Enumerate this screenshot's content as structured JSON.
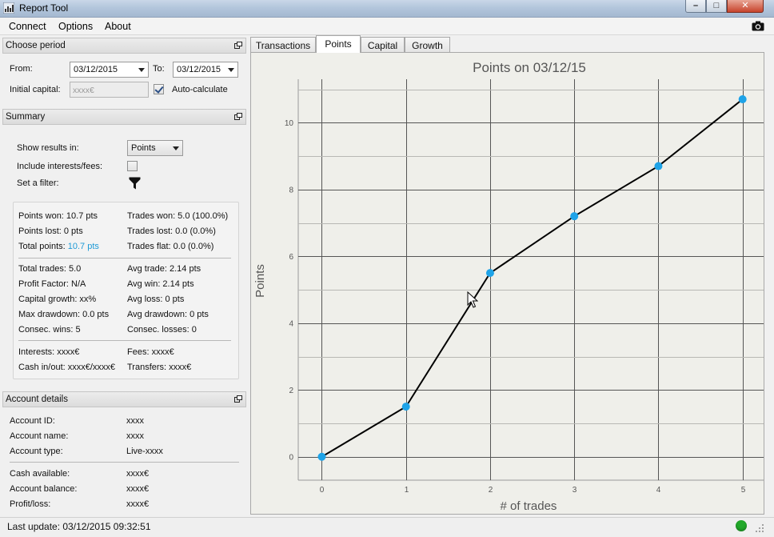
{
  "window": {
    "title": "Report Tool"
  },
  "menu": {
    "items": [
      "Connect",
      "Options",
      "About"
    ]
  },
  "choose_period": {
    "header": "Choose period",
    "from_label": "From:",
    "from_value": "03/12/2015",
    "to_label": "To:",
    "to_value": "03/12/2015",
    "initial_capital_label": "Initial capital:",
    "initial_capital_placeholder": "xxxx€",
    "auto_calculate_label": "Auto-calculate",
    "auto_calculate_checked": true
  },
  "summary": {
    "header": "Summary",
    "show_results_label": "Show results in:",
    "show_results_value": "Points",
    "include_interests_label": "Include interests/fees:",
    "include_interests_checked": false,
    "filter_label": "Set a filter:",
    "stats_left_1": [
      "Points won: 10.7 pts",
      "Points lost: 0 pts",
      "Total points: "
    ],
    "total_points_value": "10.7 pts",
    "stats_right_1": [
      "Trades won: 5.0 (100.0%)",
      "Trades lost: 0.0 (0.0%)",
      "Trades flat: 0.0 (0.0%)"
    ],
    "stats_left_2": [
      "Total trades: 5.0",
      "Profit Factor: N/A",
      "Capital growth: xx%",
      "Max drawdown: 0.0 pts",
      "Consec. wins: 5"
    ],
    "stats_right_2": [
      "Avg trade: 2.14 pts",
      "Avg win: 2.14 pts",
      "Avg loss: 0 pts",
      "Avg drawdown: 0 pts",
      "Consec. losses: 0"
    ],
    "stats_left_3": [
      "Interests: xxxx€",
      "Cash in/out: xxxx€/xxxx€"
    ],
    "stats_right_3": [
      "Fees: xxxx€",
      "Transfers: xxxx€"
    ]
  },
  "account_details": {
    "header": "Account details",
    "rows_1": [
      {
        "label": "Account ID:",
        "value": "xxxx"
      },
      {
        "label": "Account name:",
        "value": "xxxx"
      },
      {
        "label": "Account type:",
        "value": "Live-xxxx"
      }
    ],
    "rows_2": [
      {
        "label": "Cash available:",
        "value": "xxxx€"
      },
      {
        "label": "Account balance:",
        "value": "xxxx€"
      },
      {
        "label": "Profit/loss:",
        "value": "xxxx€"
      }
    ]
  },
  "tabs": [
    "Transactions",
    "Points",
    "Capital",
    "Growth"
  ],
  "active_tab": "Points",
  "status": {
    "last_update": "Last update: 03/12/2015 09:32:51",
    "connection_color": "#22a92a"
  },
  "icons": [
    "app-chart-icon",
    "camera-icon",
    "dock-icon",
    "filter-icon",
    "status-dot-icon",
    "size-grip-icon"
  ],
  "colors": {
    "marker": "#1ea3e8",
    "line": "#000000",
    "accent_text": "#1e9ad6",
    "grid": "#555555",
    "plot_bg": "#efefea"
  },
  "chart_data": {
    "type": "line",
    "title": "Points on 03/12/15",
    "xlabel": "# of trades",
    "ylabel": "Points",
    "x": [
      0,
      1,
      2,
      3,
      4,
      5
    ],
    "y": [
      0,
      1.5,
      5.5,
      7.2,
      8.7,
      10.7
    ],
    "xlim": [
      -0.28,
      5.25
    ],
    "ylim": [
      -0.7,
      11.3
    ],
    "xticks": [
      0,
      1,
      2,
      3,
      4,
      5
    ],
    "yticks": [
      0,
      2,
      4,
      6,
      8,
      10
    ],
    "grid": true
  }
}
